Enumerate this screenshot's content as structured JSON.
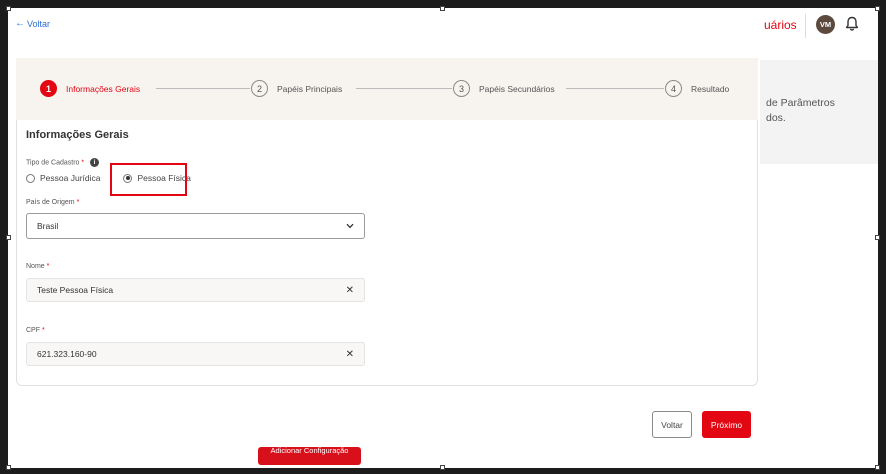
{
  "header": {
    "back_label": "Voltar",
    "users_partial": "uários",
    "avatar_initials": "VM"
  },
  "background_panel": {
    "line1": "de Parâmetros",
    "line2": "dos."
  },
  "stepper": {
    "steps": [
      {
        "number": "1",
        "label": "Informações Gerais"
      },
      {
        "number": "2",
        "label": "Papéis Principais"
      },
      {
        "number": "3",
        "label": "Papéis Secundários"
      },
      {
        "number": "4",
        "label": "Resultado"
      }
    ]
  },
  "form": {
    "title": "Informações Gerais",
    "tipo_label": "Tipo de Cadastro",
    "required_mark": "*",
    "info_glyph": "i",
    "radio_options": [
      {
        "label": "Pessoa Jurídica",
        "checked": false
      },
      {
        "label": "Pessoa Física",
        "checked": true
      }
    ],
    "pais_label": "País de Origem",
    "pais_value": "Brasil",
    "nome_label": "Nome",
    "nome_value": "Teste Pessoa Física",
    "cpf_label": "CPF",
    "cpf_value": "621.323.160-90"
  },
  "actions": {
    "voltar": "Voltar",
    "proximo": "Próximo",
    "bottom_partial": "Adicionar Configuração"
  },
  "colors": {
    "accent": "#e30613",
    "stepper_bg": "#f7f3ef"
  }
}
